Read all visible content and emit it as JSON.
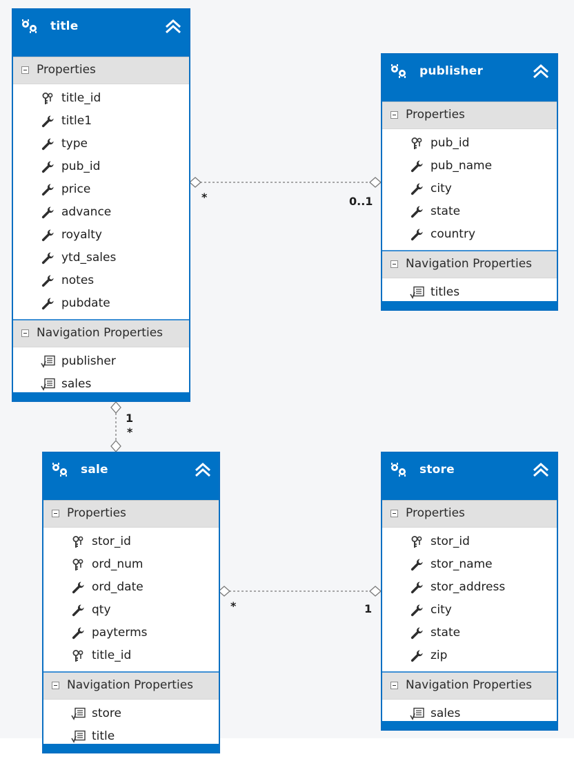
{
  "entities": {
    "title": {
      "name": "title",
      "properties_label": "Properties",
      "properties": [
        {
          "name": "title_id",
          "icon": "key-icon"
        },
        {
          "name": "title1",
          "icon": "wrench-icon"
        },
        {
          "name": "type",
          "icon": "wrench-icon"
        },
        {
          "name": "pub_id",
          "icon": "wrench-icon"
        },
        {
          "name": "price",
          "icon": "wrench-icon"
        },
        {
          "name": "advance",
          "icon": "wrench-icon"
        },
        {
          "name": "royalty",
          "icon": "wrench-icon"
        },
        {
          "name": "ytd_sales",
          "icon": "wrench-icon"
        },
        {
          "name": "notes",
          "icon": "wrench-icon"
        },
        {
          "name": "pubdate",
          "icon": "wrench-icon"
        }
      ],
      "nav_label": "Navigation Properties",
      "navigation": [
        {
          "name": "publisher",
          "icon": "navigation-property-icon"
        },
        {
          "name": "sales",
          "icon": "navigation-property-icon"
        }
      ]
    },
    "publisher": {
      "name": "publisher",
      "properties_label": "Properties",
      "properties": [
        {
          "name": "pub_id",
          "icon": "key-icon"
        },
        {
          "name": "pub_name",
          "icon": "wrench-icon"
        },
        {
          "name": "city",
          "icon": "wrench-icon"
        },
        {
          "name": "state",
          "icon": "wrench-icon"
        },
        {
          "name": "country",
          "icon": "wrench-icon"
        }
      ],
      "nav_label": "Navigation Properties",
      "navigation": [
        {
          "name": "titles",
          "icon": "navigation-property-icon"
        }
      ]
    },
    "sale": {
      "name": "sale",
      "properties_label": "Properties",
      "properties": [
        {
          "name": "stor_id",
          "icon": "key-icon"
        },
        {
          "name": "ord_num",
          "icon": "key-icon"
        },
        {
          "name": "ord_date",
          "icon": "wrench-icon"
        },
        {
          "name": "qty",
          "icon": "wrench-icon"
        },
        {
          "name": "payterms",
          "icon": "wrench-icon"
        },
        {
          "name": "title_id",
          "icon": "key-icon"
        }
      ],
      "nav_label": "Navigation Properties",
      "navigation": [
        {
          "name": "store",
          "icon": "navigation-property-icon"
        },
        {
          "name": "title",
          "icon": "navigation-property-icon"
        }
      ]
    },
    "store": {
      "name": "store",
      "properties_label": "Properties",
      "properties": [
        {
          "name": "stor_id",
          "icon": "key-icon"
        },
        {
          "name": "stor_name",
          "icon": "wrench-icon"
        },
        {
          "name": "stor_address",
          "icon": "wrench-icon"
        },
        {
          "name": "city",
          "icon": "wrench-icon"
        },
        {
          "name": "state",
          "icon": "wrench-icon"
        },
        {
          "name": "zip",
          "icon": "wrench-icon"
        }
      ],
      "nav_label": "Navigation Properties",
      "navigation": [
        {
          "name": "sales",
          "icon": "navigation-property-icon"
        }
      ]
    }
  },
  "associations": [
    {
      "from": "title",
      "to": "publisher",
      "from_multiplicity": "*",
      "to_multiplicity": "0..1"
    },
    {
      "from": "title",
      "to": "sale",
      "from_multiplicity": "1",
      "to_multiplicity": "*"
    },
    {
      "from": "sale",
      "to": "store",
      "from_multiplicity": "*",
      "to_multiplicity": "1"
    }
  ],
  "colors": {
    "header_blue": "#0072c6",
    "section_gray": "#e1e1e1",
    "canvas": "#f5f6f8"
  }
}
